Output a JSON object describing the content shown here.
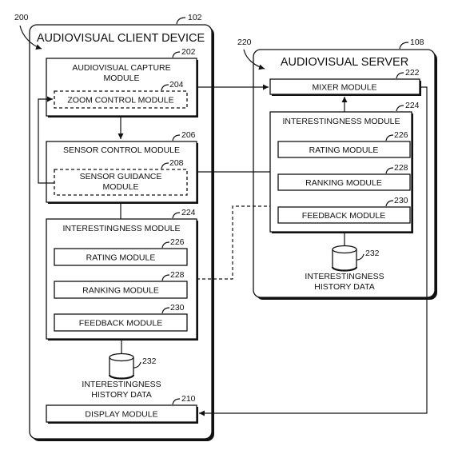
{
  "figure_refs": {
    "client_system": "200",
    "server_system": "220"
  },
  "client": {
    "title": "AUDIOVISUAL CLIENT DEVICE",
    "ref": "102",
    "capture": {
      "label_line1": "AUDIOVISUAL CAPTURE",
      "label_line2": "MODULE",
      "ref": "202",
      "zoom": {
        "label": "ZOOM CONTROL MODULE",
        "ref": "204"
      }
    },
    "sensor": {
      "label": "SENSOR CONTROL MODULE",
      "ref": "206",
      "guidance": {
        "label_line1": "SENSOR GUIDANCE",
        "label_line2": "MODULE",
        "ref": "208"
      }
    },
    "interestingness": {
      "label": "INTERESTINGNESS MODULE",
      "ref": "224",
      "rating": {
        "label": "RATING MODULE",
        "ref": "226"
      },
      "ranking": {
        "label": "RANKING MODULE",
        "ref": "228"
      },
      "feedback": {
        "label": "FEEDBACK MODULE",
        "ref": "230"
      }
    },
    "history": {
      "label_line1": "INTERESTINGNESS",
      "label_line2": "HISTORY DATA",
      "ref": "232"
    },
    "display": {
      "label": "DISPLAY MODULE",
      "ref": "210"
    }
  },
  "server": {
    "title": "AUDIOVISUAL SERVER",
    "ref": "108",
    "mixer": {
      "label": "MIXER MODULE",
      "ref": "222"
    },
    "interestingness": {
      "label": "INTERESTINGNESS MODULE",
      "ref": "224",
      "rating": {
        "label": "RATING MODULE",
        "ref": "226"
      },
      "ranking": {
        "label": "RANKING MODULE",
        "ref": "228"
      },
      "feedback": {
        "label": "FEEDBACK MODULE",
        "ref": "230"
      }
    },
    "history": {
      "label_line1": "INTERESTINGNESS",
      "label_line2": "HISTORY DATA",
      "ref": "232"
    }
  }
}
